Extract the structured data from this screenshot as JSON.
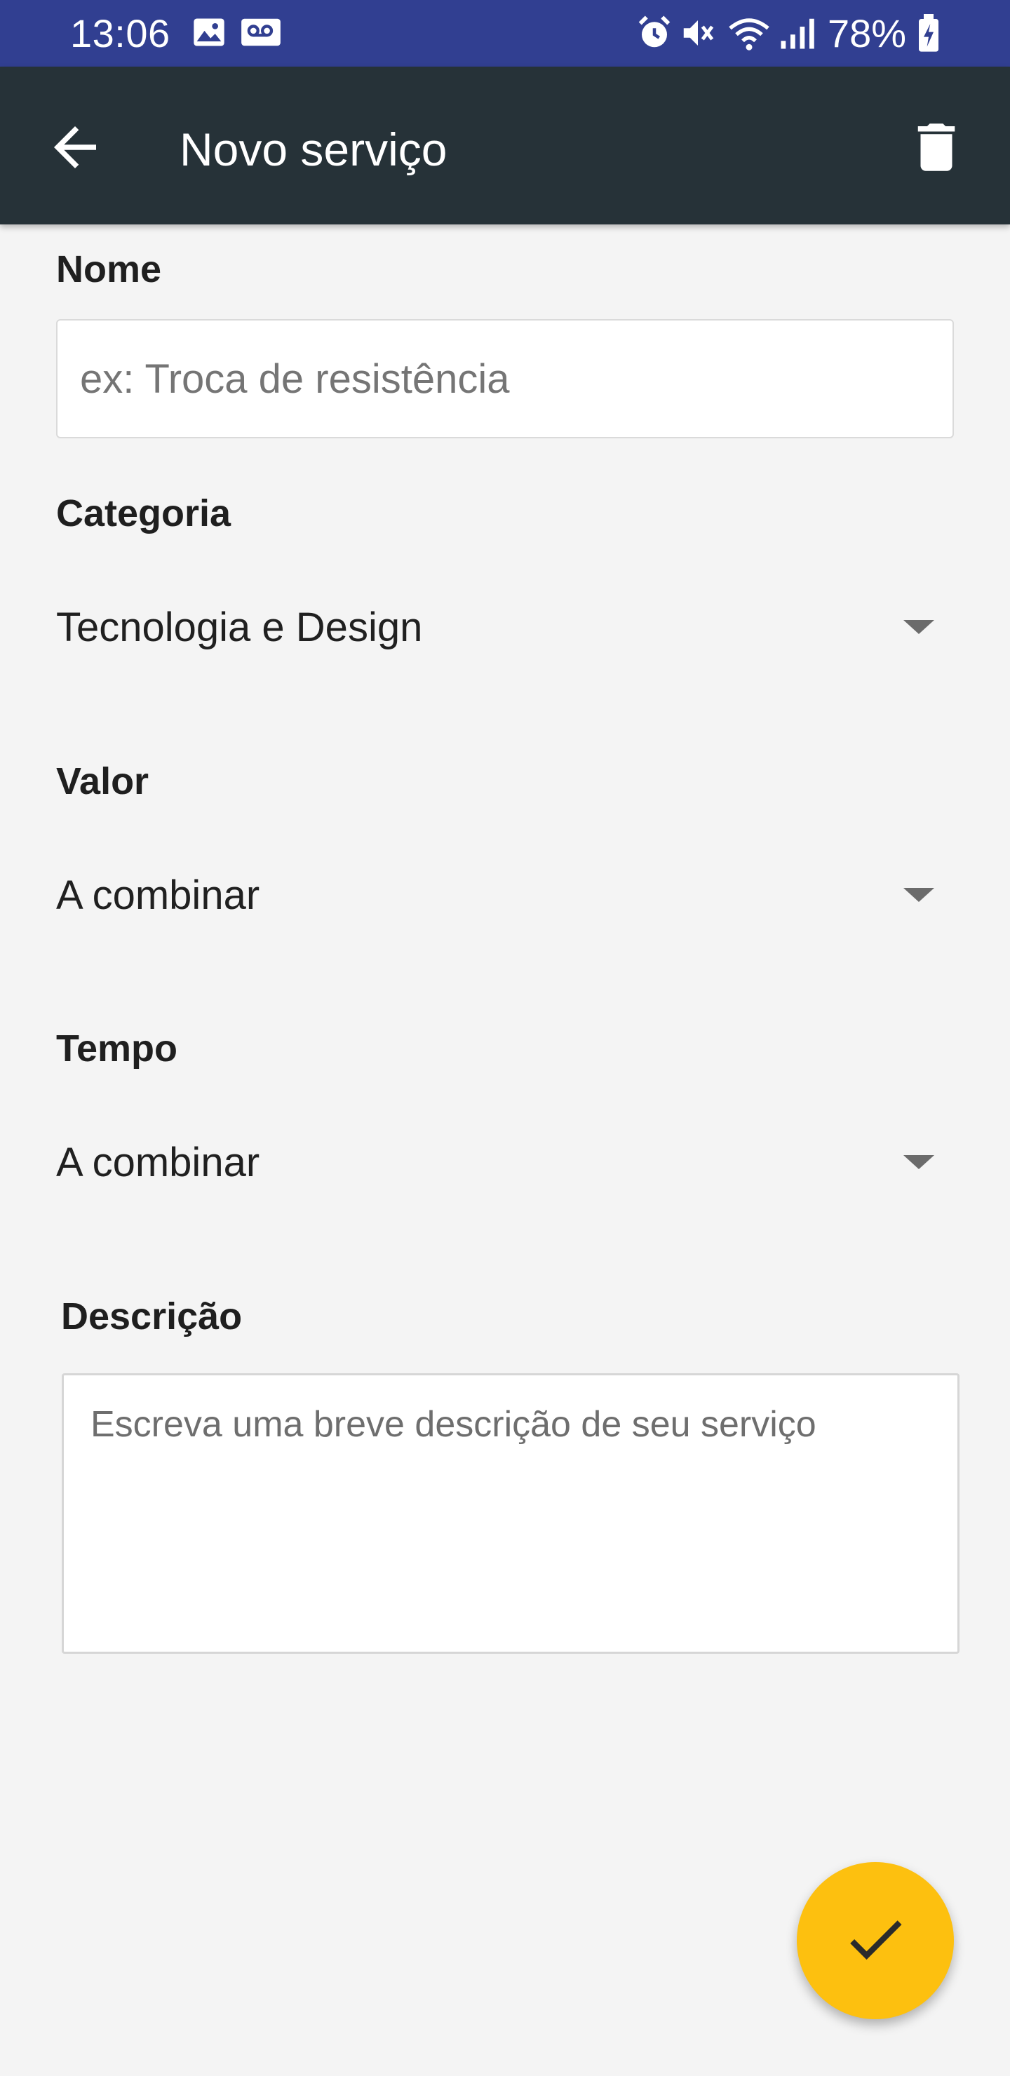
{
  "status_bar": {
    "time": "13:06",
    "battery": "78%",
    "background": "#313f91",
    "left_icons": [
      "image-icon",
      "voicemail-icon"
    ],
    "right_icons": [
      "alarm-icon",
      "vibrate-mute-icon",
      "wifi-icon",
      "signal-icon",
      "battery-charging-icon"
    ]
  },
  "app_bar": {
    "title": "Novo serviço",
    "background": "#263238",
    "back_icon": "arrow-left-icon",
    "delete_icon": "trash-icon"
  },
  "form": {
    "nome": {
      "label": "Nome",
      "value": "",
      "placeholder": "ex: Troca de resistência"
    },
    "categoria": {
      "label": "Categoria",
      "selected": "Tecnologia e Design"
    },
    "valor": {
      "label": "Valor",
      "selected": "A combinar"
    },
    "tempo": {
      "label": "Tempo",
      "selected": "A combinar"
    },
    "descricao": {
      "label": "Descrição",
      "value": "",
      "placeholder": "Escreva uma breve descrição de seu serviço"
    }
  },
  "fab": {
    "icon": "check-icon",
    "color": "#fdc00f"
  }
}
